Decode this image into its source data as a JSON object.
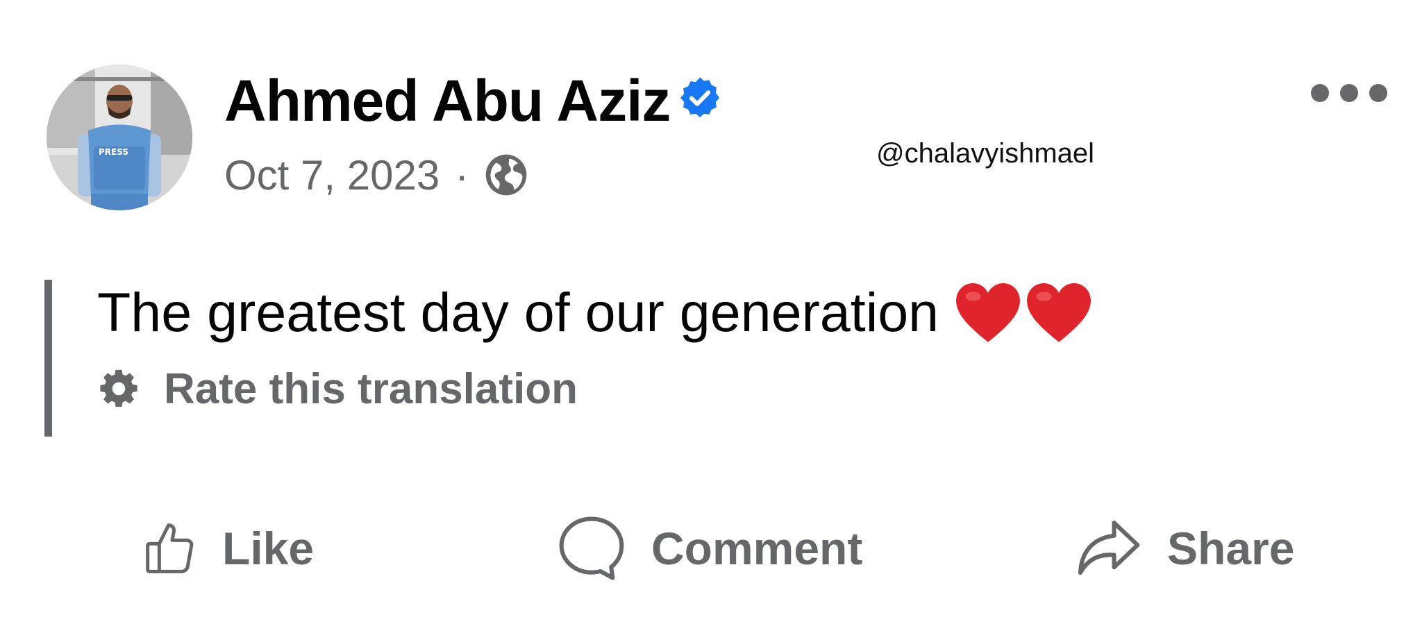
{
  "post": {
    "author": {
      "name": "Ahmed Abu Aziz",
      "verified": true,
      "avatar_vest_text": "PRESS"
    },
    "date": "Oct 7, 2023",
    "separator": "·",
    "audience_icon": "globe-icon",
    "watermark": "@chalavyishmael",
    "more_icon": "more-horizontal-icon",
    "text": "The greatest day of our generation",
    "emoji": [
      "❤️",
      "❤️"
    ],
    "translation": {
      "icon": "gear-icon",
      "label": "Rate this translation"
    },
    "actions": [
      {
        "icon": "thumbs-up-icon",
        "label": "Like"
      },
      {
        "icon": "comment-icon",
        "label": "Comment"
      },
      {
        "icon": "share-icon",
        "label": "Share"
      }
    ]
  },
  "colors": {
    "text_primary": "#050505",
    "text_secondary": "#65676b",
    "verified_badge": "#1877f2",
    "heart": "#e0242b"
  }
}
